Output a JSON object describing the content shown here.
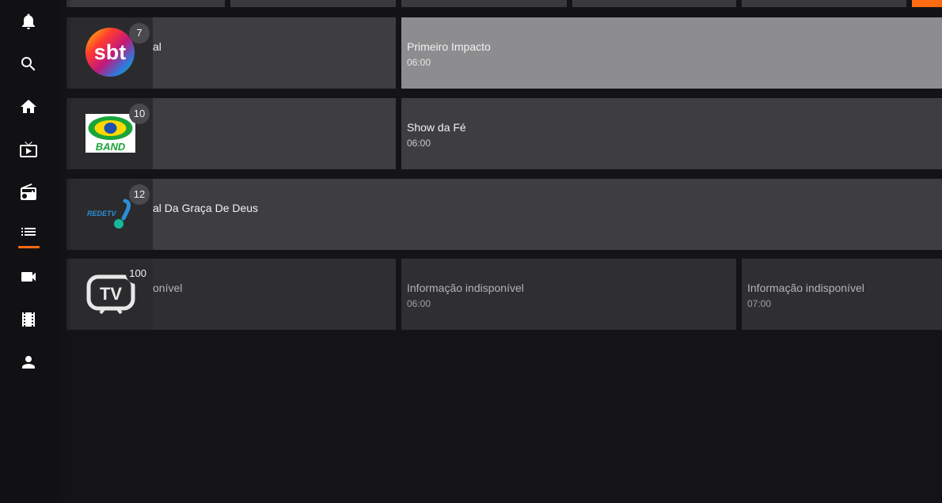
{
  "nav": {
    "items": [
      {
        "icon": "bell-icon"
      },
      {
        "icon": "search-icon"
      },
      {
        "icon": "home-icon"
      },
      {
        "icon": "tv-play-icon"
      },
      {
        "icon": "radio-icon"
      },
      {
        "icon": "list-icon",
        "active": true
      },
      {
        "icon": "videocam-icon"
      },
      {
        "icon": "film-icon"
      },
      {
        "icon": "person-icon"
      }
    ],
    "accent_color": "#ff6a13"
  },
  "guide": {
    "rows": [
      {
        "channel": {
          "number": "7",
          "logo": "sbt-logo",
          "logo_text": "sbt"
        },
        "programs": [
          {
            "title": "al",
            "time": ""
          },
          {
            "title": "Primeiro Impacto",
            "time": "06:00",
            "focused": true
          }
        ]
      },
      {
        "channel": {
          "number": "10",
          "logo": "band-logo",
          "logo_text": "BAND"
        },
        "programs": [
          {
            "title": "",
            "time": ""
          },
          {
            "title": "Show da Fé",
            "time": "06:00"
          }
        ]
      },
      {
        "channel": {
          "number": "12",
          "logo": "redetv-logo",
          "logo_text": "REDETV"
        },
        "programs": [
          {
            "title": "al Da Graça De Deus",
            "time": ""
          }
        ]
      },
      {
        "channel": {
          "number": "100",
          "logo": "tv-logo",
          "logo_text": "TV"
        },
        "programs": [
          {
            "title": "onível",
            "time": ""
          },
          {
            "title": "Informação indisponível",
            "time": "06:00"
          },
          {
            "title": "Informação indisponível",
            "time": "07:00"
          }
        ]
      }
    ]
  }
}
